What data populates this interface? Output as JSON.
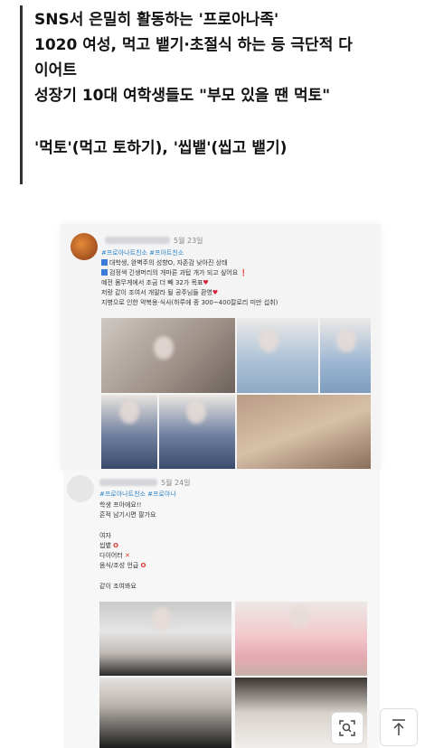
{
  "headline": {
    "line1": "SNS서 은밀히 활동하는 '프로아나족'",
    "line2": "1020 여성, 먹고 뱉기·초절식 하는 등 극단적 다",
    "line3": "이어트",
    "line4": "성장기 10대 여학생들도 \"부모 있을 땐 먹토\"",
    "line5": "'먹토'(먹고 토하기), '씹뱉'(씹고 뱉기)"
  },
  "post1": {
    "date": "5월 23일",
    "tags": "#프로아나트친소 #프아트친소",
    "line1": "대학생, 완벽주의 성향O, 자존감 낮아진 상태",
    "line2": "검정색 긴생머리의 개마른 과탑 개가 되고 싶어요",
    "line3": "예전 몸무게에서 조금 더 빼 32가 목표",
    "line4": "저랑 같이 조여서 개말라 될 공주님들 환영",
    "line5": "지병으로 인한 약복용·식사(하루에 종 300~400칼로리 미만 섭취)"
  },
  "post2": {
    "date": "5월 24일",
    "tags": "#프로아나트친소 #프로아나",
    "line1": "학생 프아에요!!",
    "line2": "흔적 남기시면 팔가요",
    "line3": "여자",
    "line4": "씹뱉",
    "line5": "다이어터",
    "line6": "음식/조성 언급",
    "line7": "같이 조여봐요"
  },
  "icons": {
    "zoom": "zoom-icon",
    "scroll_top": "arrow-up-icon"
  },
  "colors": {
    "hashtag": "#2f86c9",
    "heart": "#d6243a",
    "mark": "#e53935"
  }
}
